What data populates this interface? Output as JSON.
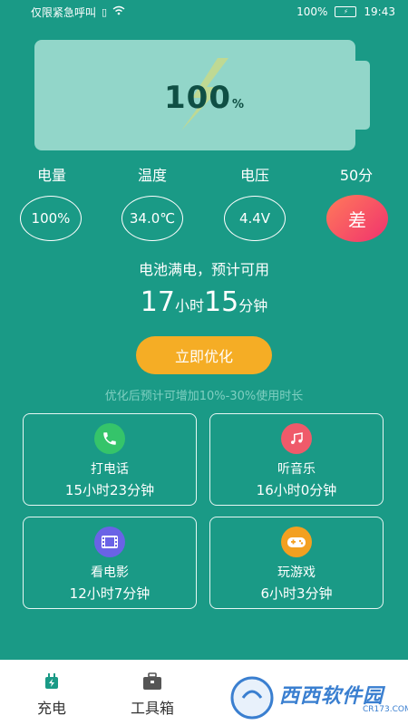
{
  "status_bar": {
    "carrier_text": "仅限紧急呼叫",
    "battery_percent": "100%",
    "time": "19:43"
  },
  "battery": {
    "percent_value": "100",
    "percent_unit": "%"
  },
  "stats": {
    "labels": [
      "电量",
      "温度",
      "电压",
      "50分"
    ],
    "values": [
      "100%",
      "34.0℃",
      "4.4V"
    ],
    "grade": "差"
  },
  "status_text": "电池满电，预计可用",
  "remaining": {
    "hours": "17",
    "hours_unit": "小时",
    "minutes": "15",
    "minutes_unit": "分钟"
  },
  "optimize_button": "立即优化",
  "hint": "优化后预计可增加10%-30%使用时长",
  "cards": [
    {
      "title": "打电话",
      "value": "15小时23分钟",
      "icon": "phone-icon",
      "color": "#35c46a"
    },
    {
      "title": "听音乐",
      "value": "16小时0分钟",
      "icon": "music-icon",
      "color": "#ef5a6a"
    },
    {
      "title": "看电影",
      "value": "12小时7分钟",
      "icon": "film-icon",
      "color": "#6a63e6"
    },
    {
      "title": "玩游戏",
      "value": "6小时3分钟",
      "icon": "gamepad-icon",
      "color": "#f3a020"
    }
  ],
  "nav": {
    "items": [
      {
        "label": "充电",
        "icon": "charging-plug-icon"
      },
      {
        "label": "工具箱",
        "icon": "toolbox-icon"
      }
    ]
  },
  "watermark": {
    "text": "西西软件园",
    "sub": "CR173.COM"
  }
}
